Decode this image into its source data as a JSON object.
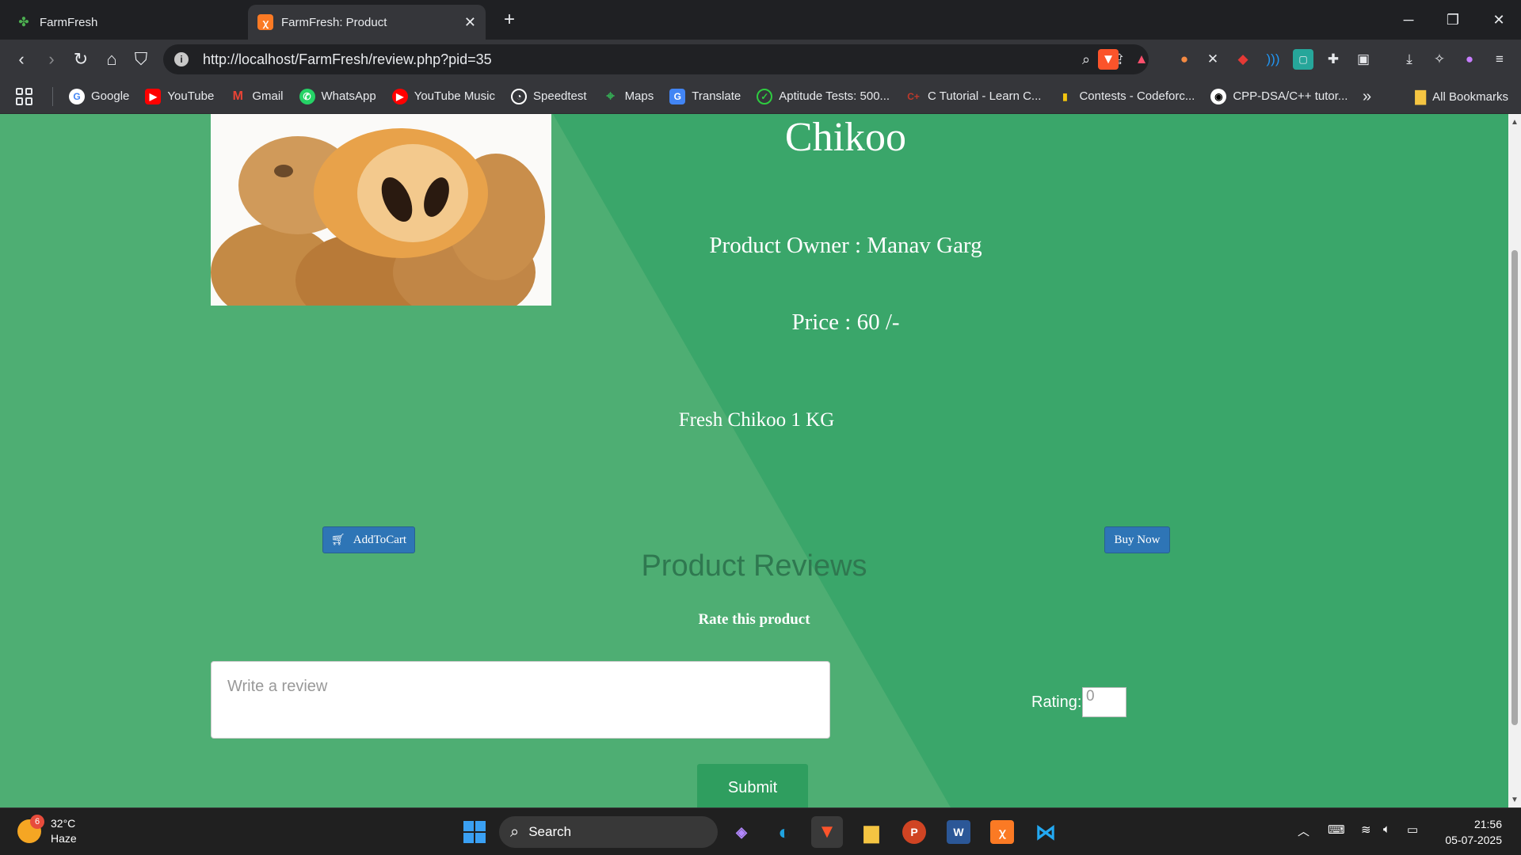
{
  "browser": {
    "tabs": [
      {
        "title": "FarmFresh",
        "active": false
      },
      {
        "title": "FarmFresh: Product",
        "active": true
      }
    ],
    "url": "http://localhost/FarmFresh/review.php?pid=35",
    "bookmarks": [
      {
        "label": "Google",
        "icon": "google-icon",
        "color": "#4285f4"
      },
      {
        "label": "YouTube",
        "icon": "youtube-icon",
        "color": "#ff0000"
      },
      {
        "label": "Gmail",
        "icon": "gmail-icon",
        "color": "#ea4335"
      },
      {
        "label": "WhatsApp",
        "icon": "whatsapp-icon",
        "color": "#25d366"
      },
      {
        "label": "YouTube Music",
        "icon": "youtube-music-icon",
        "color": "#ff0000"
      },
      {
        "label": "Speedtest",
        "icon": "speedtest-icon",
        "color": "#141526"
      },
      {
        "label": "Maps",
        "icon": "maps-icon",
        "color": "#34a853"
      },
      {
        "label": "Translate",
        "icon": "translate-icon",
        "color": "#4285f4"
      },
      {
        "label": "Aptitude Tests: 500...",
        "icon": "check-circle-icon",
        "color": "#2ecc40"
      },
      {
        "label": "C Tutorial - Learn C...",
        "icon": "cpp-icon",
        "color": "#c0392b"
      },
      {
        "label": "Contests - Codeforc...",
        "icon": "codeforces-icon",
        "color": "#f1c40f"
      },
      {
        "label": "CPP-DSA/C++ tutor...",
        "icon": "github-icon",
        "color": "#ffffff"
      }
    ],
    "all_bookmarks_label": "All Bookmarks"
  },
  "product": {
    "name": "Chikoo",
    "owner_text": "Product Owner : Manav Garg",
    "price_text": "Price : 60 /-",
    "description": "Fresh Chikoo 1 KG",
    "add_to_cart_label": "AddToCart",
    "buy_now_label": "Buy Now"
  },
  "reviews": {
    "heading": "Product Reviews",
    "rate_label": "Rate this product",
    "review_placeholder": "Write a review",
    "rating_label": "Rating:",
    "rating_value": "0",
    "submit_label": "Submit"
  },
  "taskbar": {
    "weather_badge": "6",
    "temperature": "32°C",
    "condition": "Haze",
    "search_label": "Search",
    "time": "21:56",
    "date": "05-07-2025"
  },
  "colors": {
    "page_bg": "#3aa66a",
    "diag_light": "#4eae73",
    "button_blue": "#2e75b6"
  }
}
